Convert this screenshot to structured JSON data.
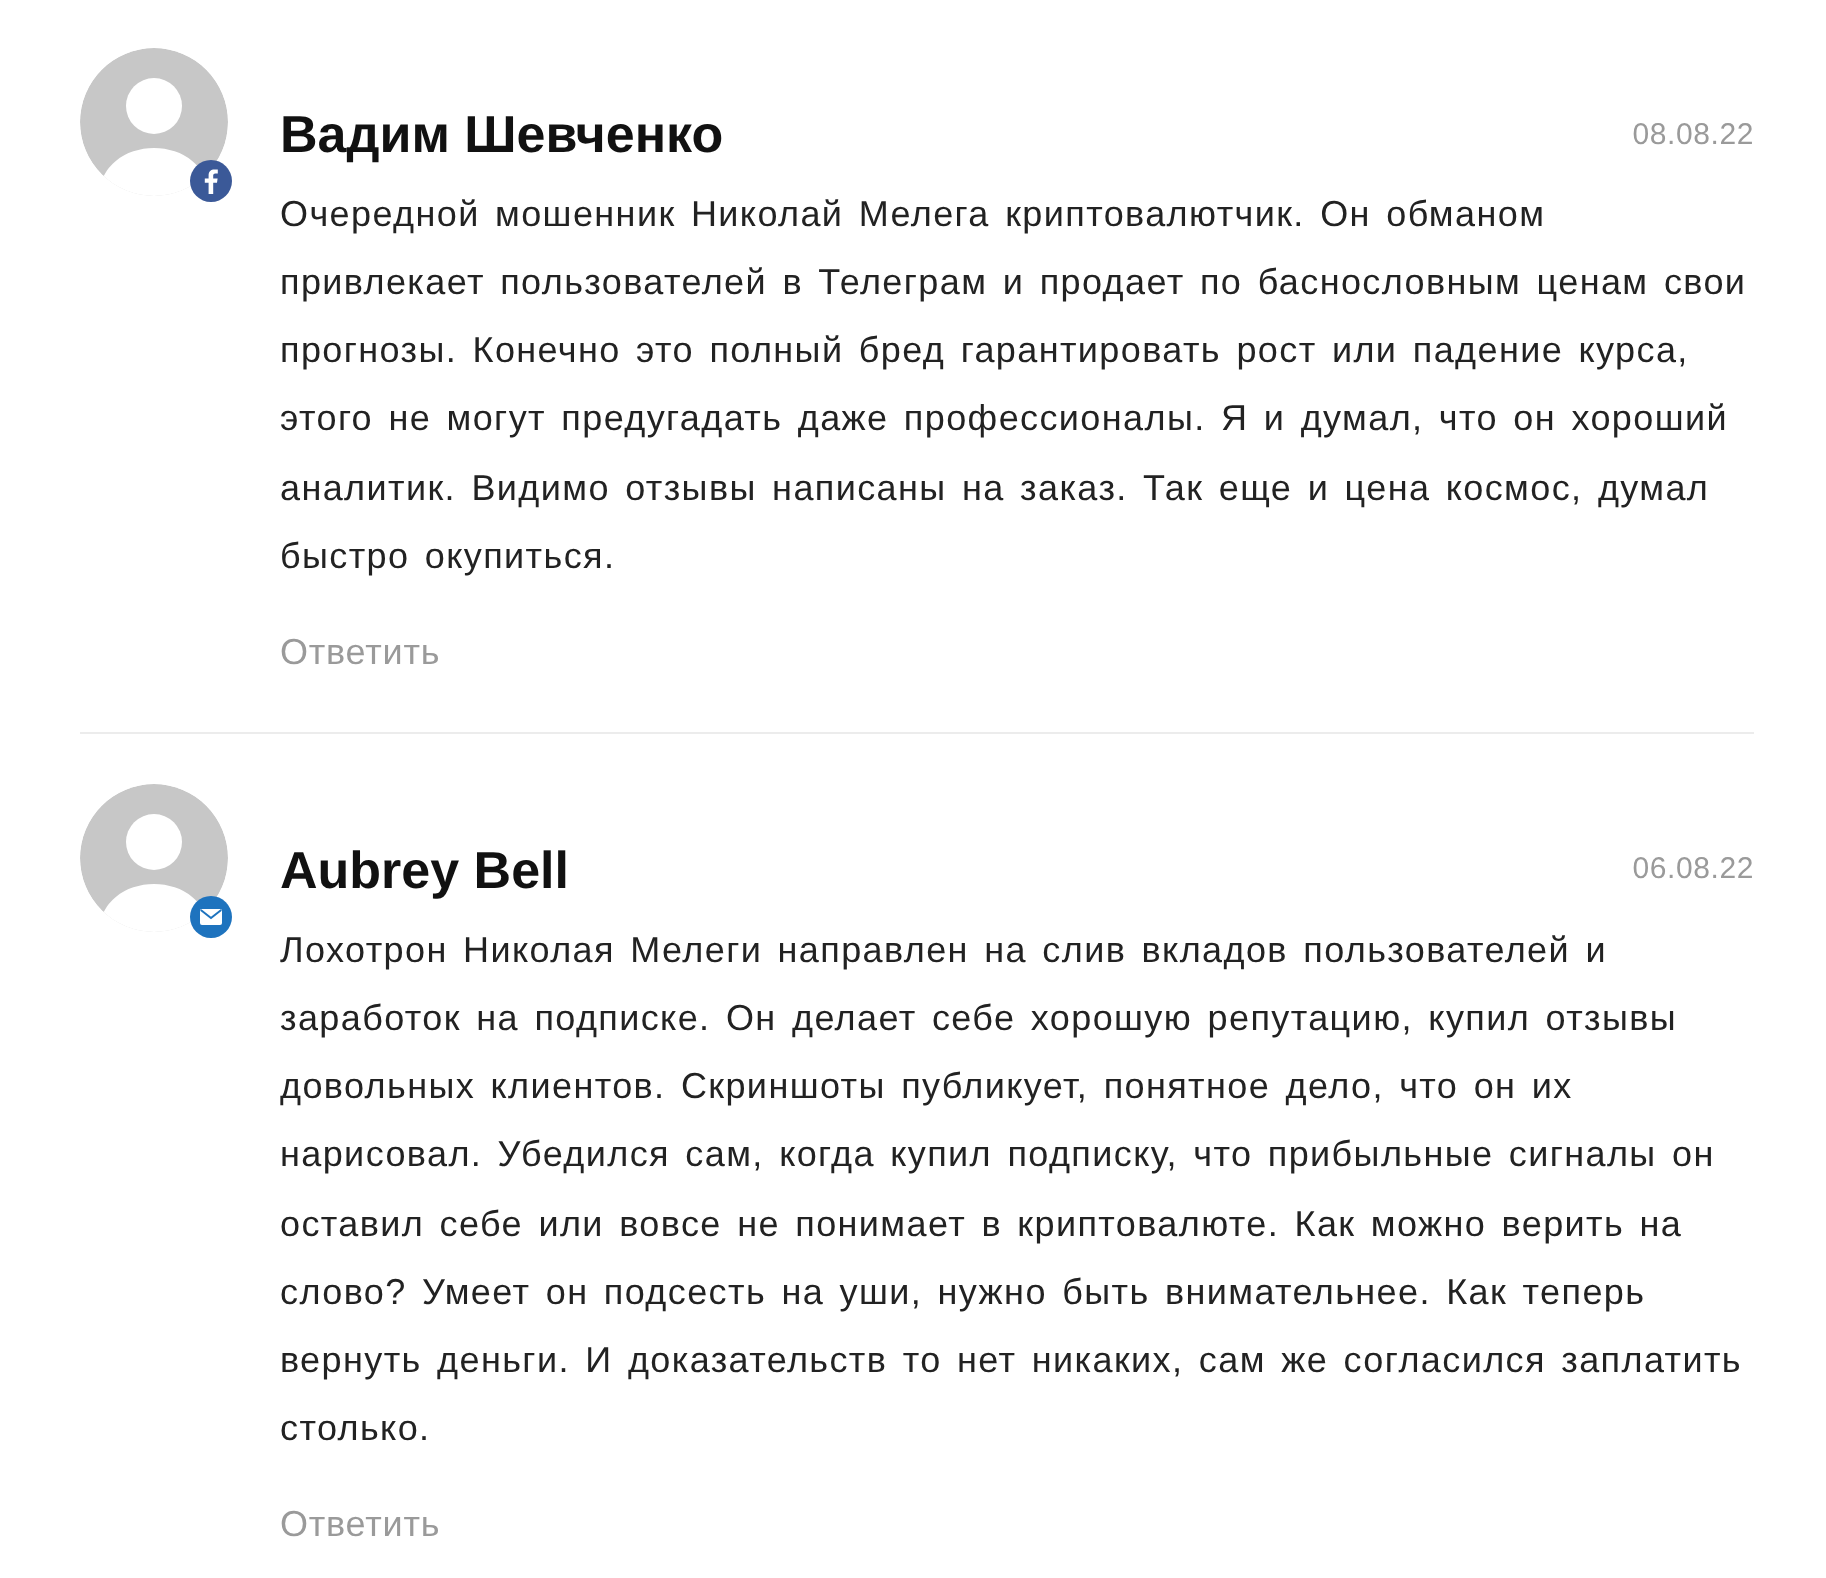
{
  "comments": [
    {
      "author": "Вадим Шевченко",
      "date": "08.08.22",
      "badge": {
        "kind": "facebook"
      },
      "text": "Очередной мошенник Николай Мелега криптовалютчик. Он обманом привлекает пользователей в Телеграм и продает по баснословным ценам свои прогнозы. Конечно это полный бред гарантировать рост или падение курса, этого не могут предугадать даже профессионалы. Я и думал, что он хороший аналитик. Видимо отзывы написаны на заказ. Так еще и цена космос, думал быстро окупиться.",
      "reply": "Ответить"
    },
    {
      "author": "Aubrey Bell",
      "date": "06.08.22",
      "badge": {
        "kind": "email"
      },
      "text": "Лохотрон Николая Мелеги направлен на слив вкладов пользователей и заработок на подписке. Он делает себе хорошую репутацию, купил отзывы довольных клиентов. Скриншоты публикует, понятное дело, что он их нарисовал. Убедился сам, когда купил подписку, что прибыльные сигналы он оставил себе или вовсе не понимает в криптовалюте. Как можно верить на слово? Умеет он подсесть на уши, нужно быть внимательнее. Как теперь вернуть деньги. И доказательств то нет никаких, сам же согласился заплатить столько.",
      "reply": "Ответить"
    }
  ]
}
